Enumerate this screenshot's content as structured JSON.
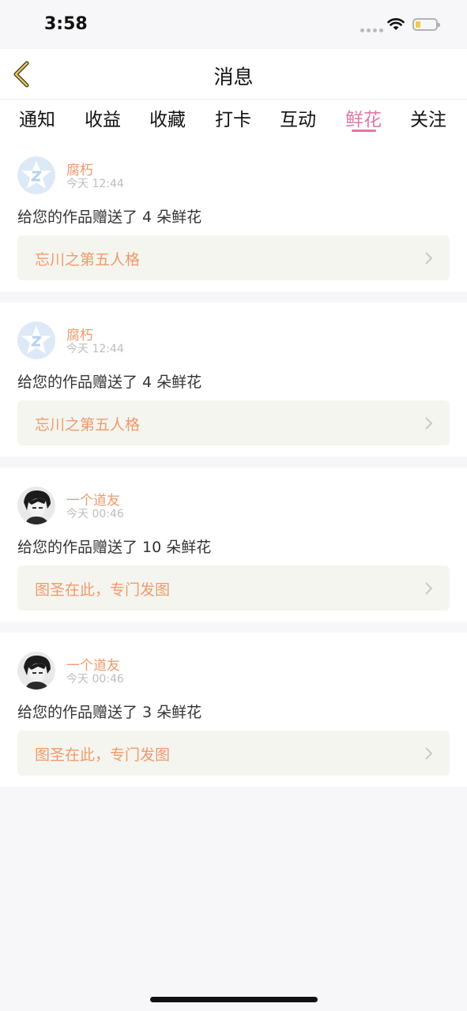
{
  "status_bar": {
    "time": "3:58"
  },
  "header": {
    "title": "消息"
  },
  "tabs": [
    {
      "label": "通知"
    },
    {
      "label": "收益"
    },
    {
      "label": "收藏"
    },
    {
      "label": "打卡"
    },
    {
      "label": "互动"
    },
    {
      "label": "鲜花",
      "active": true
    },
    {
      "label": "关注"
    }
  ],
  "messages": [
    {
      "avatar": "qq-star-avatar",
      "username": "腐朽",
      "time": "今天 12:44",
      "text": "给您的作品赠送了 4 朵鲜花",
      "work_title": "忘川之第五人格"
    },
    {
      "avatar": "qq-star-avatar",
      "username": "腐朽",
      "time": "今天 12:44",
      "text": "给您的作品赠送了 4 朵鲜花",
      "work_title": "忘川之第五人格"
    },
    {
      "avatar": "anime-avatar",
      "username": "一个道友",
      "time": "今天 00:46",
      "text": "给您的作品赠送了 10 朵鲜花",
      "work_title": "图圣在此，专门发图"
    },
    {
      "avatar": "anime-avatar",
      "username": "一个道友",
      "time": "今天 00:46",
      "text": "给您的作品赠送了 3 朵鲜花",
      "work_title": "图圣在此，专门发图"
    }
  ],
  "colors": {
    "accent": "#e277a6",
    "username": "#ef9a6c",
    "link_bg": "#f5f5ef"
  }
}
